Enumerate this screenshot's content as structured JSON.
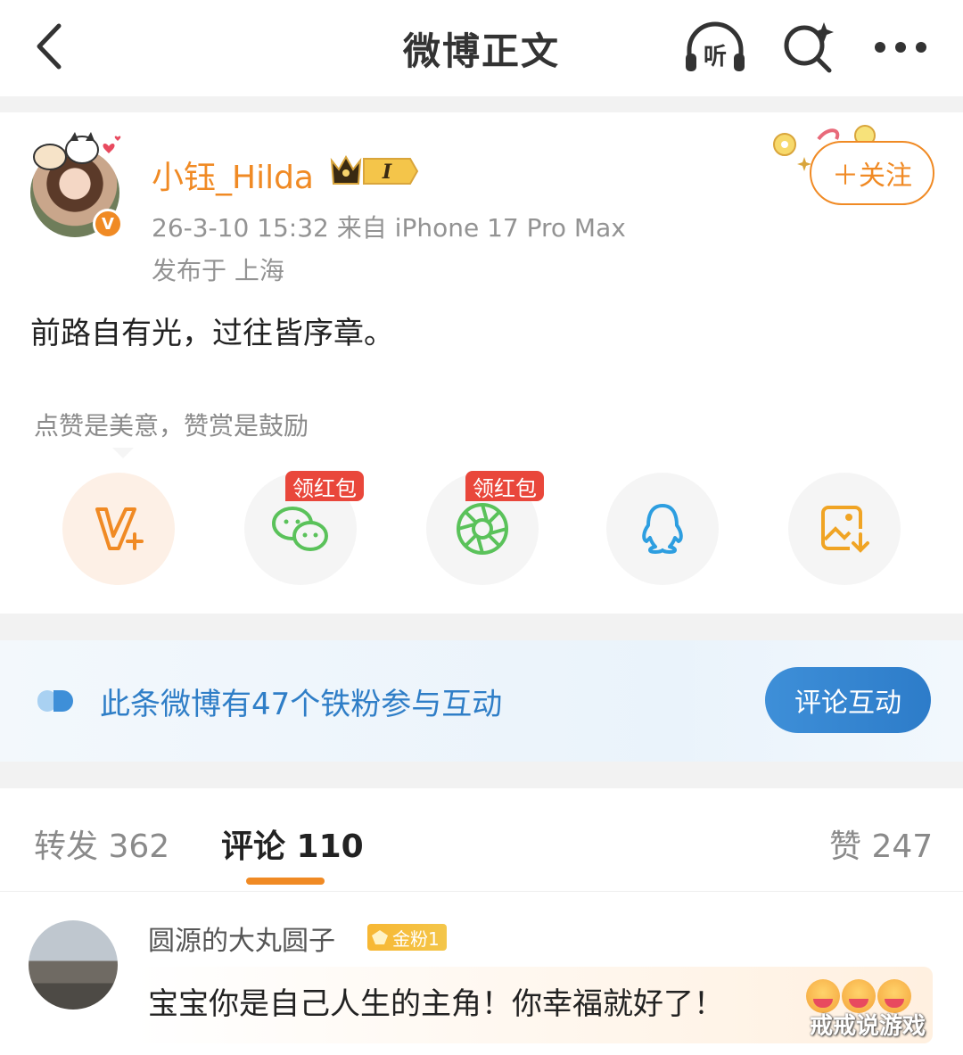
{
  "nav": {
    "title": "微博正文",
    "icons": [
      "back-arrow-icon",
      "listen-headphones-icon",
      "search-sparkle-icon",
      "more-dots-icon"
    ],
    "listen_label": "听"
  },
  "post": {
    "username": "小钰_Hilda",
    "vip_level": "I",
    "time_source": "26-3-10 15:32  来自 iPhone 17 Pro Max",
    "location": "发布于 上海",
    "follow_label": "＋关注",
    "verified_mark": "V",
    "content": "前路自有光，过往皆序章。",
    "hint": "点赞是美意，赞赏是鼓励",
    "share_actions": [
      {
        "name": "reward",
        "icon": "v-plus-icon"
      },
      {
        "name": "wechat",
        "icon": "wechat-icon",
        "tag": "领红包"
      },
      {
        "name": "moments",
        "icon": "moments-icon",
        "tag": "领红包"
      },
      {
        "name": "qq",
        "icon": "qq-penguin-icon"
      },
      {
        "name": "save-image",
        "icon": "save-image-icon"
      }
    ]
  },
  "fans_banner": {
    "text": "此条微博有47个铁粉参与互动",
    "button": "评论互动"
  },
  "tabs": {
    "repost": "转发 362",
    "comments": "评论 110",
    "likes": "赞 247",
    "active": "comments"
  },
  "comment": {
    "name": "圆源的大丸圆子",
    "badge": "金粉1",
    "text": "宝宝你是自己人生的主角！你幸福就好了！"
  },
  "watermark": "戒戒说游戏",
  "colors": {
    "accent": "#f08a24",
    "link_blue": "#2f7ec7",
    "redpack": "#e9473b",
    "wechat_green": "#5ac25a"
  }
}
